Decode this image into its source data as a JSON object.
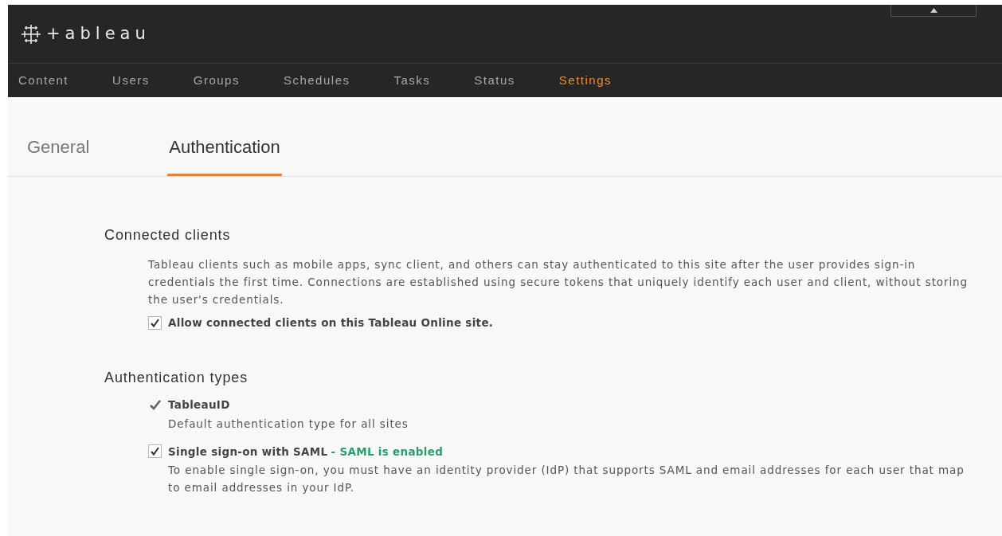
{
  "header": {
    "logo_text": "+ableau"
  },
  "nav": [
    {
      "label": "Content",
      "selected": false
    },
    {
      "label": "Users",
      "selected": false
    },
    {
      "label": "Groups",
      "selected": false
    },
    {
      "label": "Schedules",
      "selected": false
    },
    {
      "label": "Tasks",
      "selected": false
    },
    {
      "label": "Status",
      "selected": false
    },
    {
      "label": "Settings",
      "selected": true
    }
  ],
  "tabs": [
    {
      "label": "General",
      "selected": false
    },
    {
      "label": "Authentication",
      "selected": true
    }
  ],
  "connected_clients": {
    "heading": "Connected clients",
    "description": "Tableau clients such as mobile apps, sync client, and others can stay authenticated to this site after the user provides sign-in credentials the first time. Connections are established using secure tokens that uniquely identify each user and client, without storing the user's credentials.",
    "option": {
      "label": "Allow connected clients on this Tableau Online site.",
      "checked": true
    }
  },
  "authentication_types": {
    "heading": "Authentication types",
    "items": [
      {
        "kind": "fixed",
        "label": "TableauID",
        "description": "Default authentication type for all sites"
      },
      {
        "kind": "checkbox",
        "label": "Single sign-on with SAML",
        "checked": true,
        "status": "- SAML is enabled",
        "description": "To enable single sign-on, you must have an identity provider (IdP) that supports SAML and email addresses for each user that map to email addresses in your IdP."
      }
    ]
  }
}
